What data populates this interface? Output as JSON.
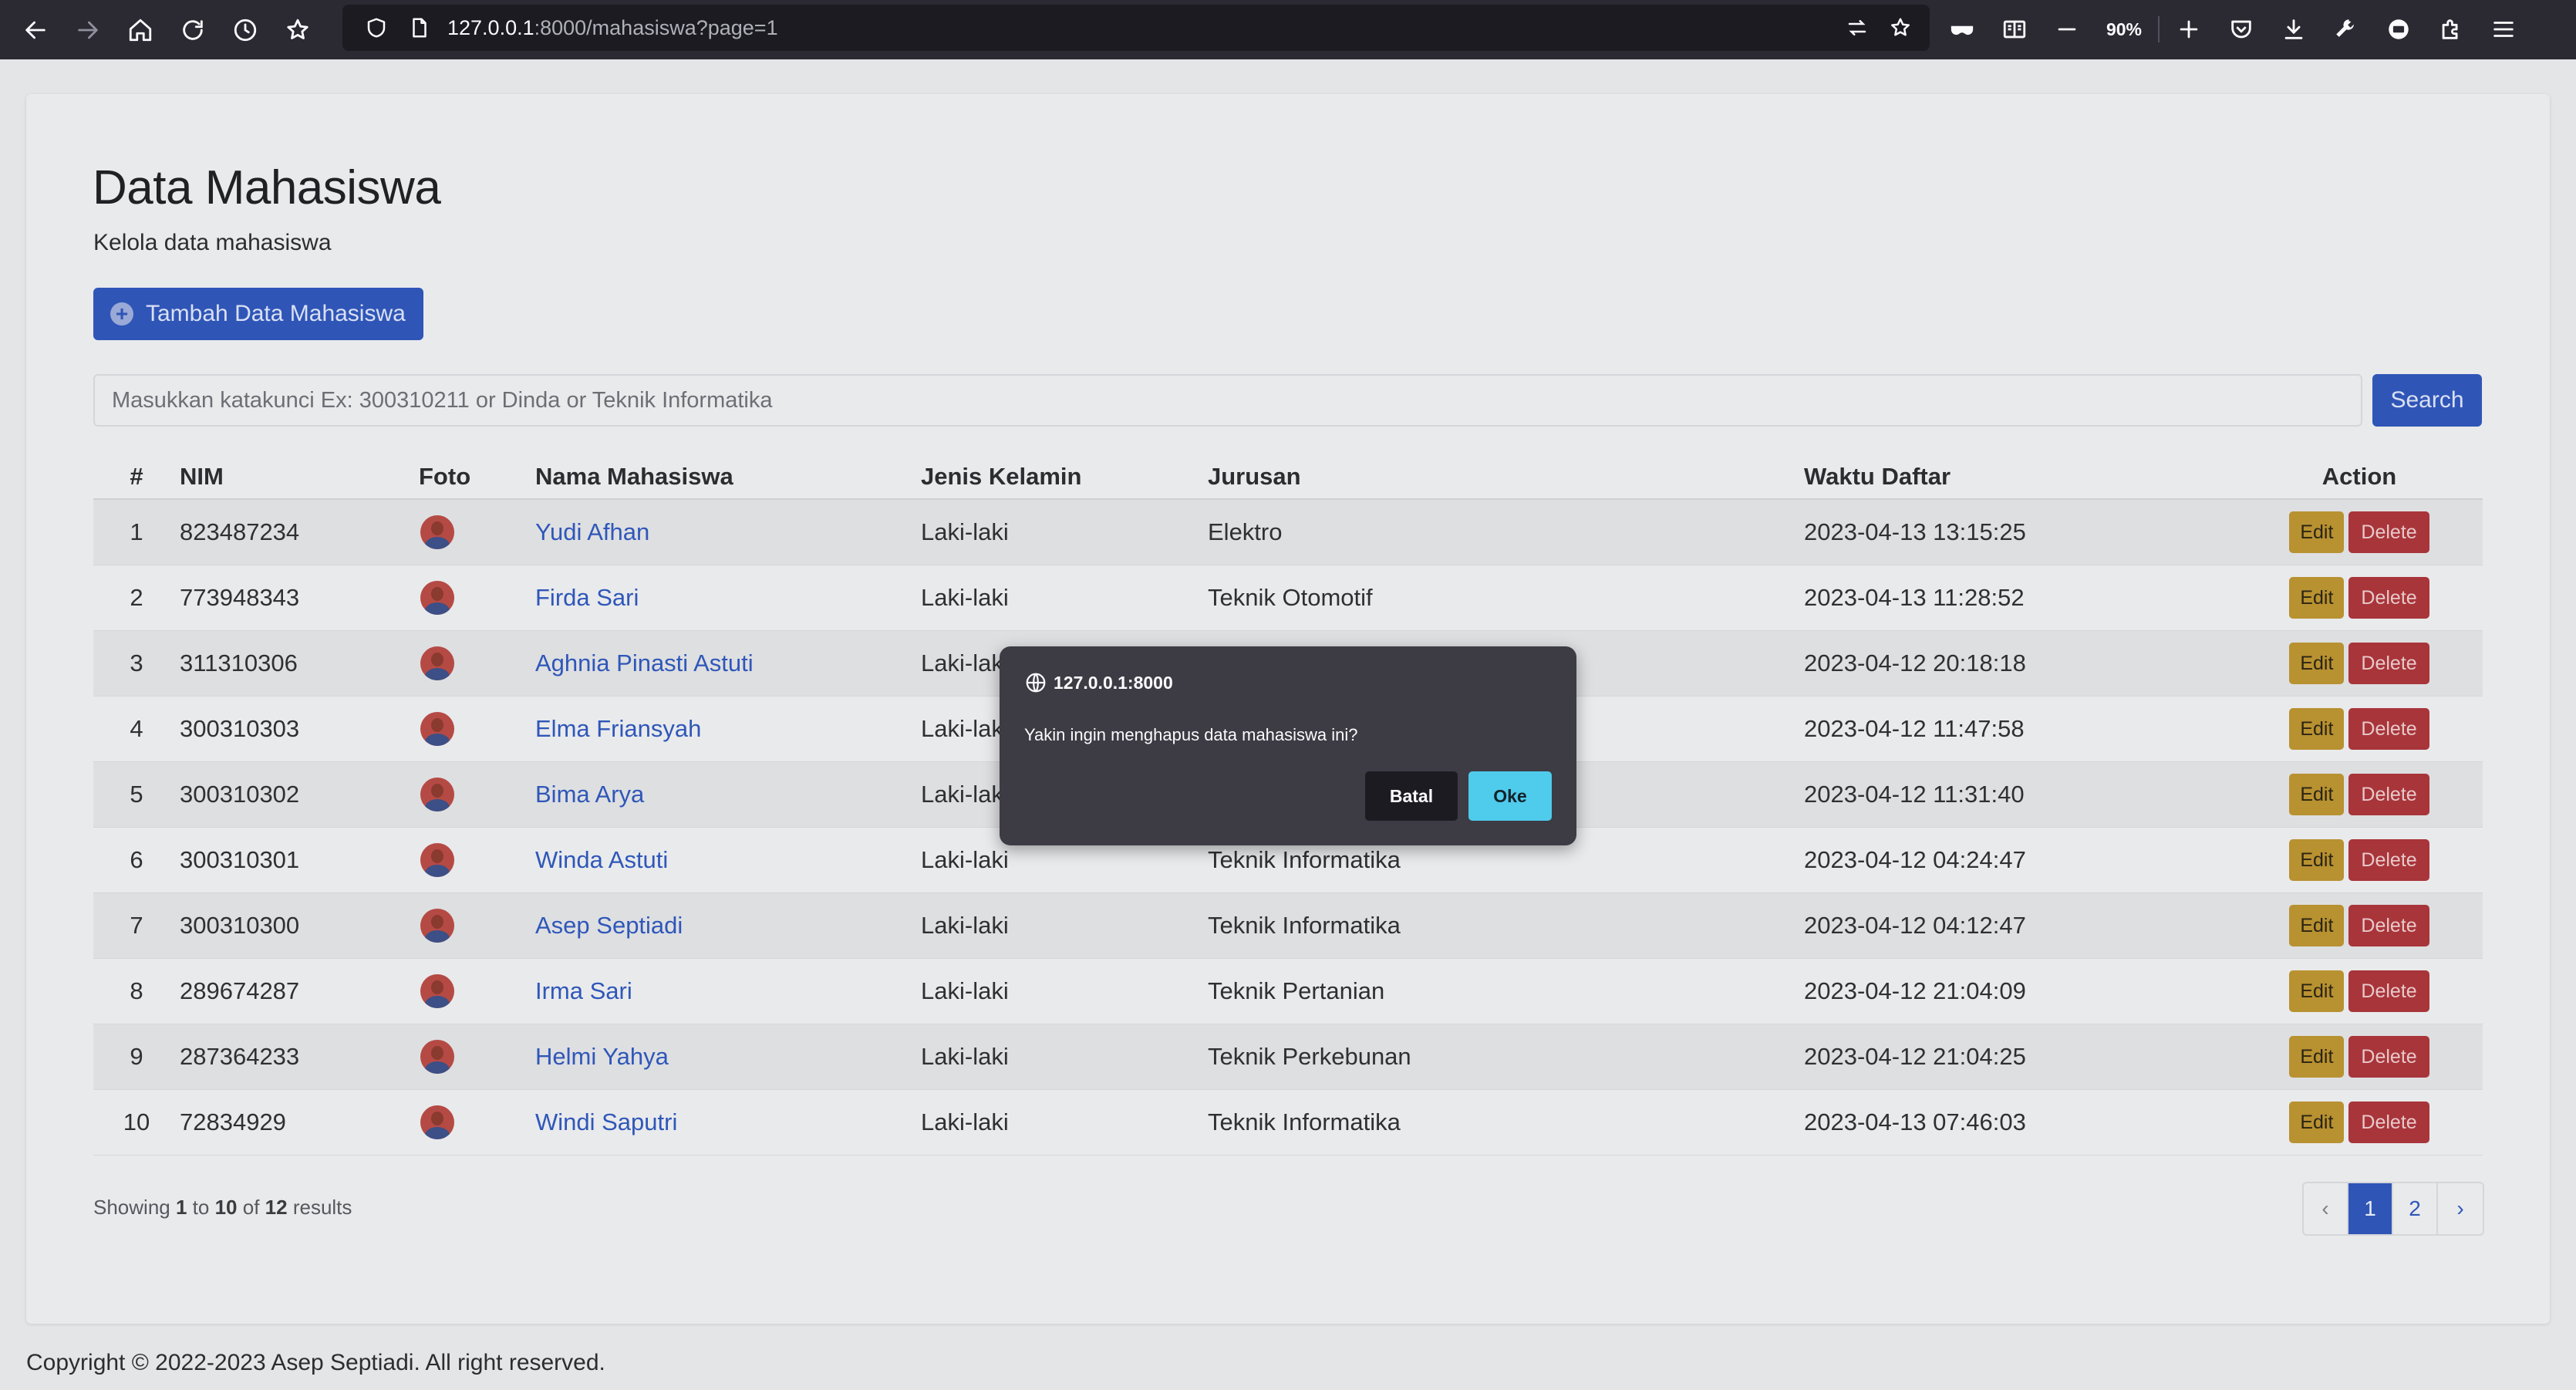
{
  "browser": {
    "url_host": "127.0.0.1",
    "url_path": ":8000/mahasiswa?page=1",
    "zoom": "90%"
  },
  "page": {
    "title": "Data Mahasiswa",
    "subtitle": "Kelola data mahasiswa",
    "add_button": "Tambah Data Mahasiswa",
    "search_placeholder": "Masukkan katakunci Ex: 300310211 or Dinda or Teknik Informatika",
    "search_button": "Search"
  },
  "table": {
    "headers": [
      "#",
      "NIM",
      "Foto",
      "Nama Mahasiswa",
      "Jenis Kelamin",
      "Jurusan",
      "Waktu Daftar",
      "Action"
    ],
    "rows": [
      {
        "no": "1",
        "nim": "823487234",
        "nama": "Yudi Afhan",
        "jk": "Laki-laki",
        "jurusan": "Elektro",
        "waktu": "2023-04-13 13:15:25"
      },
      {
        "no": "2",
        "nim": "773948343",
        "nama": "Firda Sari",
        "jk": "Laki-laki",
        "jurusan": "Teknik Otomotif",
        "waktu": "2023-04-13 11:28:52"
      },
      {
        "no": "3",
        "nim": "311310306",
        "nama": "Aghnia Pinasti Astuti",
        "jk": "Laki-laki",
        "jurusan": "",
        "waktu": "2023-04-12 20:18:18"
      },
      {
        "no": "4",
        "nim": "300310303",
        "nama": "Elma Friansyah",
        "jk": "Laki-laki",
        "jurusan": "",
        "waktu": "2023-04-12 11:47:58"
      },
      {
        "no": "5",
        "nim": "300310302",
        "nama": "Bima Arya",
        "jk": "Laki-laki",
        "jurusan": "",
        "waktu": "2023-04-12 11:31:40"
      },
      {
        "no": "6",
        "nim": "300310301",
        "nama": "Winda Astuti",
        "jk": "Laki-laki",
        "jurusan": "Teknik Informatika",
        "waktu": "2023-04-12 04:24:47"
      },
      {
        "no": "7",
        "nim": "300310300",
        "nama": "Asep Septiadi",
        "jk": "Laki-laki",
        "jurusan": "Teknik Informatika",
        "waktu": "2023-04-12 04:12:47"
      },
      {
        "no": "8",
        "nim": "289674287",
        "nama": "Irma Sari",
        "jk": "Laki-laki",
        "jurusan": "Teknik Pertanian",
        "waktu": "2023-04-12 21:04:09"
      },
      {
        "no": "9",
        "nim": "287364233",
        "nama": "Helmi Yahya",
        "jk": "Laki-laki",
        "jurusan": "Teknik Perkebunan",
        "waktu": "2023-04-12 21:04:25"
      },
      {
        "no": "10",
        "nim": "72834929",
        "nama": "Windi Saputri",
        "jk": "Laki-laki",
        "jurusan": "Teknik Informatika",
        "waktu": "2023-04-13 07:46:03"
      }
    ],
    "edit_label": "Edit",
    "delete_label": "Delete"
  },
  "pagination_info": {
    "prefix": "Showing",
    "from": "1",
    "to_word": "to",
    "to": "10",
    "of_word": "of",
    "total": "12",
    "suffix": "results"
  },
  "pagination": {
    "prev": "‹",
    "pages": [
      "1",
      "2"
    ],
    "next": "›",
    "current": "1"
  },
  "footer": "Copyright © 2022-2023 Asep Septiadi. All right reserved.",
  "dialog": {
    "origin": "127.0.0.1:8000",
    "message": "Yakin ingin menghapus data mahasiswa ini?",
    "cancel": "Batal",
    "ok": "Oke"
  },
  "colors": {
    "primary": "#2f55b7",
    "edit": "#b89130",
    "delete": "#a8353a",
    "dialog_ok": "#4fcbec"
  }
}
